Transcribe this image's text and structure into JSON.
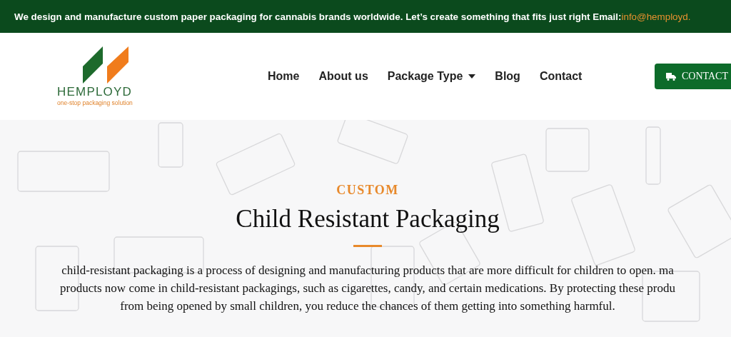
{
  "top_bar": {
    "message": "We design and manufacture custom paper packaging for cannabis brands worldwide. Let’s create something that fits just right Email:",
    "email": "info@hemployd."
  },
  "logo": {
    "name": "HEMPLOYD",
    "tagline": "one-stop packaging solution"
  },
  "nav": [
    {
      "label": "Home",
      "dropdown": false
    },
    {
      "label": "About us",
      "dropdown": false
    },
    {
      "label": "Package Type",
      "dropdown": true
    },
    {
      "label": "Blog",
      "dropdown": false
    },
    {
      "label": "Contact",
      "dropdown": false
    }
  ],
  "contact_button": {
    "label": "CONTACT"
  },
  "hero": {
    "eyebrow": "CUSTOM",
    "title": "Child Resistant Packaging",
    "paragraph_lines": [
      "child-resistant packaging is a process of designing and manufacturing products that are more difficult for children to open. ma",
      "products now come in child-resistant packagings, such as cigarettes, candy, and certain medications. By protecting these produ",
      "from being opened by small children, you reduce the chances of them getting into something harmful."
    ]
  }
}
